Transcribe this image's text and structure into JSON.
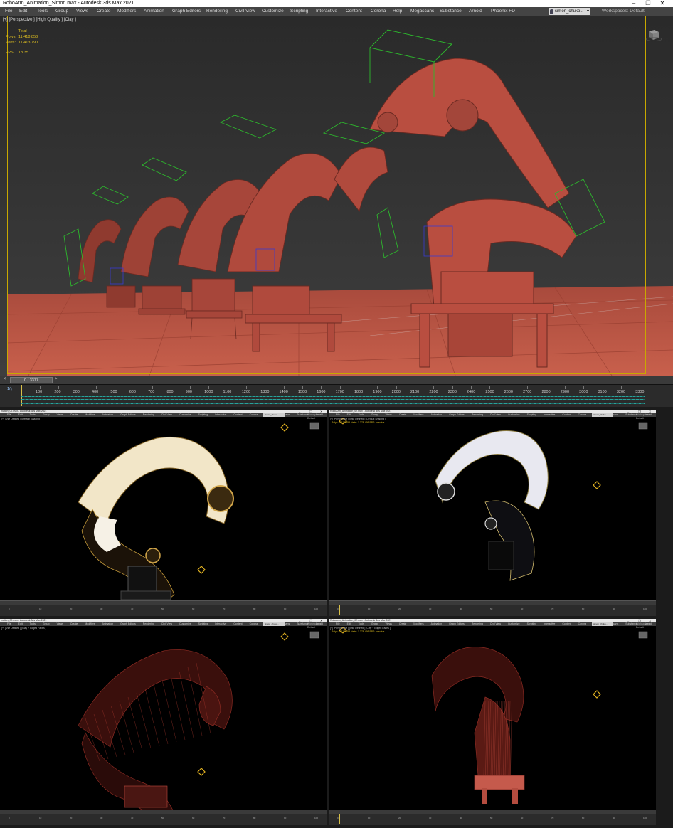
{
  "window": {
    "title": "RoboArm_Animation_Simon.max - Autodesk 3ds Max 2021",
    "controls": [
      "–",
      "❐",
      "✕"
    ]
  },
  "menu": {
    "items": [
      "File",
      "Edit",
      "Tools",
      "Group",
      "Views",
      "Create",
      "Modifiers",
      "Animation",
      "Graph Editors",
      "Rendering",
      "Civil View",
      "Customize",
      "Scripting",
      "Interactive",
      "Content",
      "Corona",
      "Help",
      "Megascans",
      "Substance",
      "Arnold",
      "Phoenix FD"
    ],
    "user": "simon_chuko...",
    "workspaces_label": "Workspaces:",
    "workspaces_value": "Default"
  },
  "viewport": {
    "label": "[+] [Perspective ] [High Quality ] [Clay ]",
    "stats": {
      "total_label": "Total",
      "polys_label": "Polys:",
      "polys_value": "11 418 853",
      "verts_label": "Verts:",
      "verts_value": "11 413 790",
      "fps_label": "FPS:",
      "fps_value": "18.35"
    },
    "colors": {
      "background": "#2c2c2c",
      "floor": "#c25645",
      "robot": "#b4493c",
      "border": "#c8a800"
    }
  },
  "timeline": {
    "frame_display": "0 / 3377",
    "prev_icon": "<",
    "next_icon": ">",
    "ticks": [
      "100",
      "200",
      "300",
      "400",
      "500",
      "600",
      "700",
      "800",
      "900",
      "1000",
      "1100",
      "1200",
      "1300",
      "1400",
      "1500",
      "1600",
      "1700",
      "1800",
      "1900",
      "2000",
      "2100",
      "2200",
      "2300",
      "2400",
      "2500",
      "2600",
      "2700",
      "2800",
      "2900",
      "3000",
      "3100",
      "3200",
      "3300"
    ],
    "fps_tag": "1/₀"
  },
  "panels": [
    {
      "title": "nation_02.max - Autodesk 3ds Max 2021",
      "label": "[+] [Use Defined ] [Default Shading ]",
      "style": "gold-shaded",
      "stats": "",
      "user": "simon_chuko...",
      "workspace": "Workspaces: Default"
    },
    {
      "title": "RoboArm_Animation_02.max - Autodesk 3ds Max 2021",
      "label": "[+] [Perspective ] [Use Defined ] [Default Shading ]",
      "style": "white-shaded",
      "stats": "Polys: 1 419 853  Verts: 1 378 495  FPS: Inactive",
      "user": "simon_chuko...",
      "workspace": "Workspaces: Default"
    },
    {
      "title": "nation_02.max - Autodesk 3ds Max 2021",
      "label": "[+] [Use Defined ] [Clay + Edged Faces ]",
      "style": "red-wire",
      "stats": "",
      "user": "simon_chuko...",
      "workspace": "Workspaces: Default"
    },
    {
      "title": "RoboArm_Animation_02.max - Autodesk 3ds Max 2021",
      "label": "[+] [Perspective ] [Use Defined ] [Clay + Edged Faces ]",
      "style": "red-wire",
      "stats": "Polys: 1 419 853  Verts: 1 378 495  FPS: Inactive",
      "user": "simon_chuko...",
      "workspace": "Workspaces: Default"
    }
  ],
  "panel_menu": [
    "File",
    "Edit",
    "Tools",
    "Group",
    "Views",
    "Create",
    "Modifiers",
    "Animation",
    "Graph Editors",
    "Rendering",
    "Civil View",
    "Customize",
    "Scripting",
    "Interactive",
    "Content",
    "Corona",
    "Help",
    "Megascans",
    "Substance",
    "Arnold",
    "Phoenix FD"
  ],
  "panel_ticks": [
    "0",
    "10",
    "20",
    "30",
    "40",
    "50",
    "60",
    "70",
    "80",
    "90",
    "100"
  ]
}
